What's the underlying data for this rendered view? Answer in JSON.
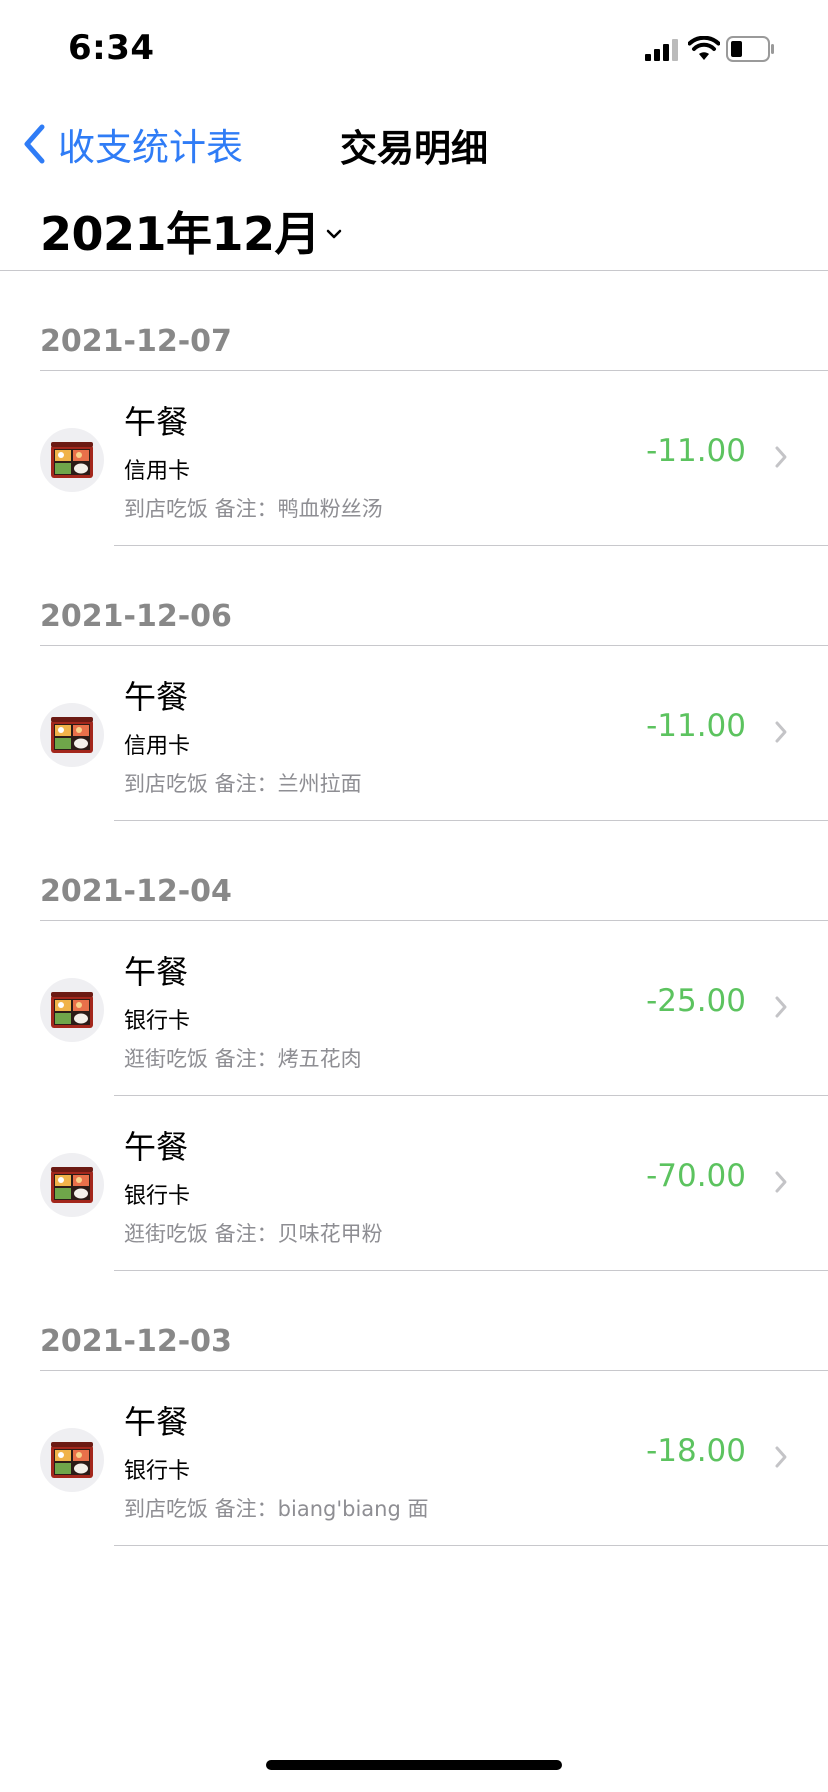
{
  "status_bar": {
    "time": "6:34",
    "icons": [
      "cellular-signal-icon",
      "wifi-icon",
      "battery-icon"
    ]
  },
  "nav": {
    "back_label": "收支统计表",
    "title": "交易明细"
  },
  "month_picker": {
    "label": "2021年12月"
  },
  "colors": {
    "accent": "#2f7cf6",
    "amount": "#5cc35f",
    "secondary_text": "#8e8e93",
    "date_header": "#888888",
    "divider": "#c8c8cc"
  },
  "groups": [
    {
      "date": "2021-12-07",
      "items": [
        {
          "icon": "bento-box-icon",
          "title": "午餐",
          "account": "信用卡",
          "note": "到店吃饭 备注：鸭血粉丝汤",
          "amount": "-11.00"
        }
      ]
    },
    {
      "date": "2021-12-06",
      "items": [
        {
          "icon": "bento-box-icon",
          "title": "午餐",
          "account": "信用卡",
          "note": "到店吃饭 备注：兰州拉面",
          "amount": "-11.00"
        }
      ]
    },
    {
      "date": "2021-12-04",
      "items": [
        {
          "icon": "bento-box-icon",
          "title": "午餐",
          "account": "银行卡",
          "note": "逛街吃饭 备注：烤五花肉",
          "amount": "-25.00"
        },
        {
          "icon": "bento-box-icon",
          "title": "午餐",
          "account": "银行卡",
          "note": "逛街吃饭 备注：贝味花甲粉",
          "amount": "-70.00"
        }
      ]
    },
    {
      "date": "2021-12-03",
      "items": [
        {
          "icon": "bento-box-icon",
          "title": "午餐",
          "account": "银行卡",
          "note": "到店吃饭 备注：biang'biang 面",
          "amount": "-18.00"
        }
      ]
    }
  ]
}
